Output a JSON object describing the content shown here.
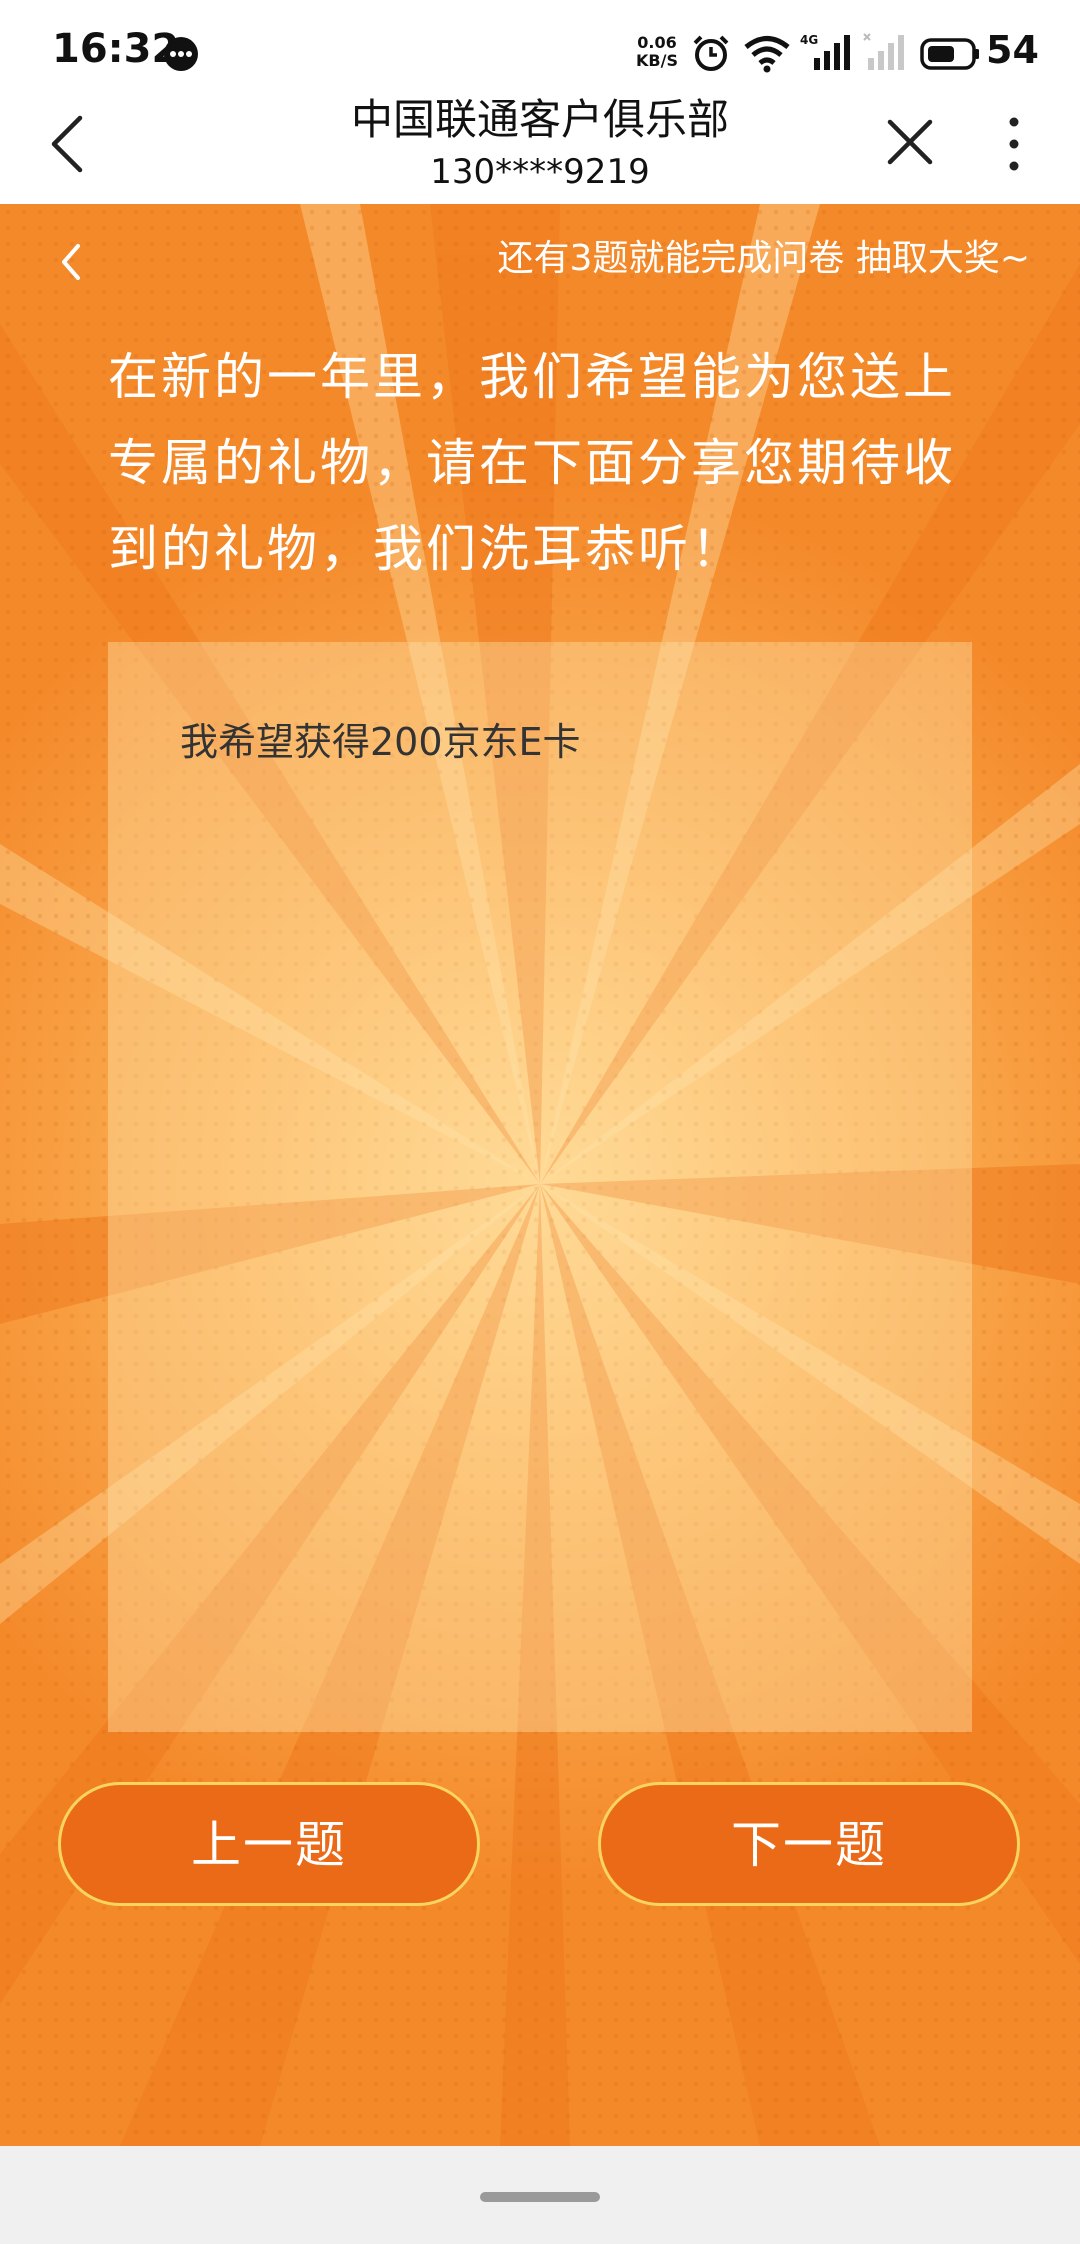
{
  "status_bar": {
    "time": "16:32",
    "net_speed_value": "0.06",
    "net_speed_unit": "KB/S",
    "network_type": "4G",
    "battery_level": "54",
    "icons": [
      "message-icon",
      "alarm-icon",
      "wifi-icon",
      "signal-icon",
      "signal-no-sim-icon",
      "battery-icon"
    ]
  },
  "header": {
    "title": "中国联通客户俱乐部",
    "subtitle": "130****9219",
    "back_icon": "chevron-left-icon",
    "close_icon": "close-icon",
    "more_icon": "more-vertical-icon"
  },
  "survey": {
    "back_icon": "chevron-left-icon",
    "progress_text": "还有3题就能完成问卷 抽取大奖~",
    "question": "在新的一年里，我们希望能为您送上专属的礼物，请在下面分享您期待收到的礼物，我们洗耳恭听！",
    "answer": "我希望获得200京东E卡",
    "prev_label": "上一题",
    "next_label": "下一题"
  },
  "colors": {
    "background": "#f4892a",
    "button": "#ea6a17",
    "button_border": "#f9d45e",
    "text_light": "#ffffff",
    "answer_text": "#333333"
  }
}
